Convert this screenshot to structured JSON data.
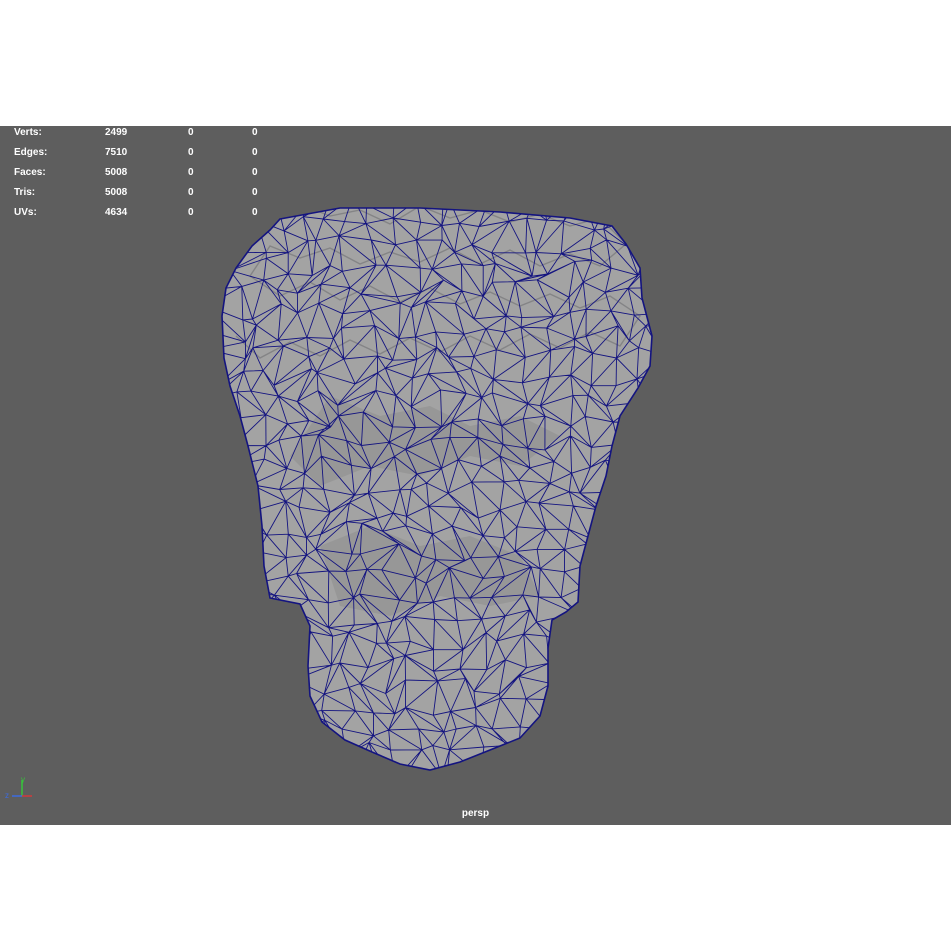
{
  "hud": {
    "rows": [
      {
        "label": "Verts:",
        "total": "2499",
        "selected": "0",
        "highlighted": "0"
      },
      {
        "label": "Edges:",
        "total": "7510",
        "selected": "0",
        "highlighted": "0"
      },
      {
        "label": "Faces:",
        "total": "5008",
        "selected": "0",
        "highlighted": "0"
      },
      {
        "label": "Tris:",
        "total": "5008",
        "selected": "0",
        "highlighted": "0"
      },
      {
        "label": "UVs:",
        "total": "4634",
        "selected": "0",
        "highlighted": "0"
      }
    ]
  },
  "camera": {
    "name": "persp"
  },
  "axis": {
    "y_label": "y",
    "z_label": "z",
    "x_color": "#d23a3a",
    "y_color": "#37c53b",
    "z_color": "#3b6be0"
  },
  "colors": {
    "viewport_bg": "#5e5e5e",
    "mesh_fill": "#a3a3a3",
    "wire": "#141480"
  }
}
